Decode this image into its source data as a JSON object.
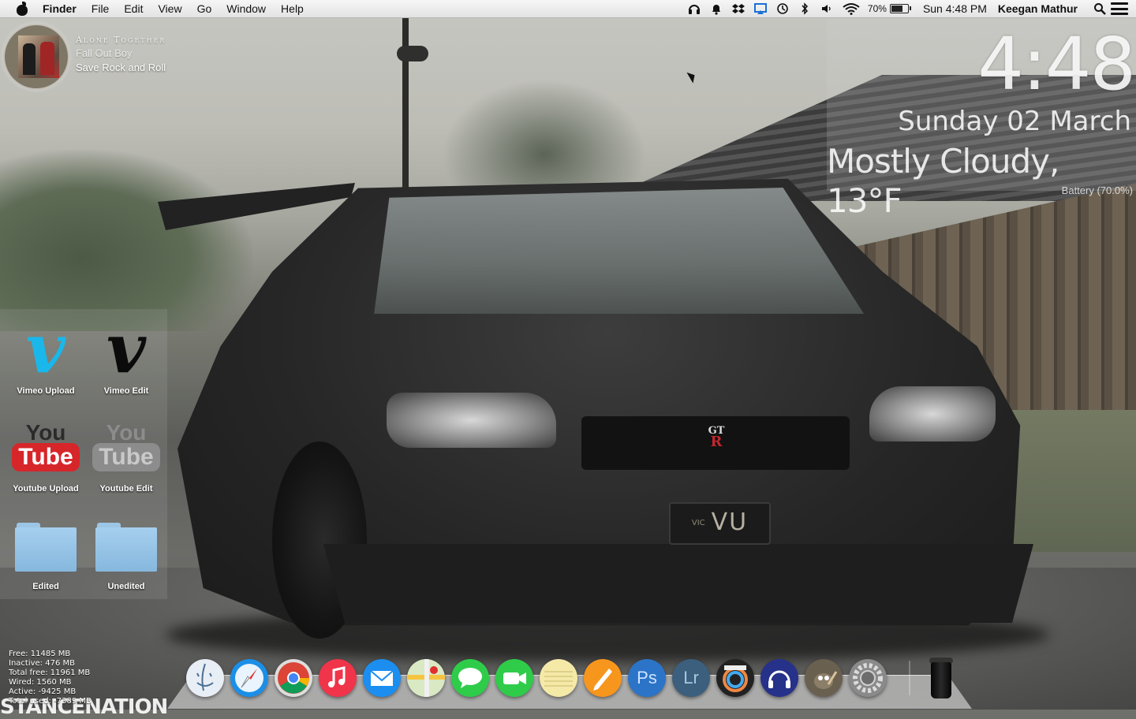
{
  "menubar": {
    "app_name": "Finder",
    "menus": [
      "File",
      "Edit",
      "View",
      "Go",
      "Window",
      "Help"
    ],
    "status_icons": [
      "headphones-icon",
      "notification-bell-icon",
      "dropbox-icon",
      "airplay-icon",
      "time-machine-icon",
      "bluetooth-icon",
      "volume-icon",
      "wifi-icon"
    ],
    "battery_percent": "70%",
    "battery_level": 0.7,
    "clock": "Sun 4:48 PM",
    "user": "Keegan Mathur"
  },
  "now_playing": {
    "song": "Alone Together",
    "artist": "Fall Out Boy",
    "album": "Save Rock and Roll"
  },
  "clock_widget": {
    "time": "4:48",
    "date": "Sunday 02 March",
    "weather": "Mostly Cloudy, 13°F",
    "battery": "Battery (70.0%)"
  },
  "desktop_icons": {
    "vimeo_upload": "Vimeo Upload",
    "vimeo_edit": "Vimeo Edit",
    "youtube_upload": "Youtube Upload",
    "youtube_edit": "Youtube Edit",
    "folder_edited": "Edited",
    "folder_unedited": "Unedited",
    "youtube_you": "You",
    "youtube_tube": "Tube"
  },
  "memory_stats": [
    "Free: 11485 MB",
    "Inactive: 476 MB",
    "Total free: 11961 MB",
    "Wired: 1560 MB",
    "Active: -9425 MB",
    "Total used: -7389 MB"
  ],
  "wallpaper": {
    "logo_text": "STANCENATION",
    "plate_small": "VIC",
    "plate_text": "VU",
    "badge_top": "GT",
    "badge_bottom": "R"
  },
  "dock": {
    "apps": [
      {
        "name": "finder",
        "icon": "finder-icon",
        "color": "#e8eef5"
      },
      {
        "name": "safari",
        "icon": "safari-icon",
        "color": "#1b8fe8"
      },
      {
        "name": "chrome",
        "icon": "chrome-icon",
        "color": "#dddddd"
      },
      {
        "name": "itunes",
        "icon": "itunes-icon",
        "color": "#f0344a"
      },
      {
        "name": "mail",
        "icon": "mail-icon",
        "color": "#1c8ef0"
      },
      {
        "name": "maps",
        "icon": "maps-icon",
        "color": "#d9e9c4"
      },
      {
        "name": "messages",
        "icon": "messages-icon",
        "color": "#2fcc4a"
      },
      {
        "name": "facetime",
        "icon": "facetime-icon",
        "color": "#2fcc4a"
      },
      {
        "name": "notes",
        "icon": "notes-icon",
        "color": "#f5e9a8"
      },
      {
        "name": "pages",
        "icon": "pages-icon",
        "color": "#f7961d"
      },
      {
        "name": "photoshop",
        "icon": "photoshop-icon",
        "color": "#2b74c8"
      },
      {
        "name": "lightroom",
        "icon": "lightroom-icon",
        "color": "#3b5f7d"
      },
      {
        "name": "final-cut",
        "icon": "final-cut-icon",
        "color": "#222222"
      },
      {
        "name": "audio-app",
        "icon": "headphones-app-icon",
        "color": "#26318a"
      },
      {
        "name": "gimp",
        "icon": "gimp-icon",
        "color": "#6a6050"
      },
      {
        "name": "system-preferences",
        "icon": "gear-icon",
        "color": "#8a8a8a"
      }
    ],
    "photoshop_label": "Ps",
    "lightroom_label": "Lr"
  }
}
